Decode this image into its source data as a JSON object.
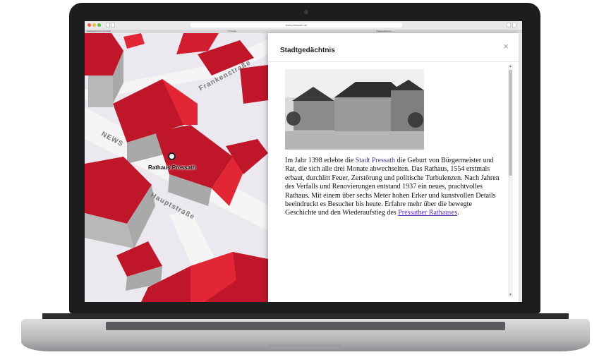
{
  "browser": {
    "url": "www.pressath.de",
    "tabs": [
      "Stadtgedächtnis Pressath",
      "Pressath",
      "Stadtgedächtnis"
    ]
  },
  "map": {
    "marker_label": "Rathaus Pressath",
    "streets": [
      "Frankenstraße",
      "NEWS",
      "Hauptstraße"
    ],
    "colors": {
      "roof": "#c0162a",
      "roof_light": "#e32636",
      "wall": "#a9a9a9",
      "ground": "#ece8f0",
      "road": "#f5f5f5"
    }
  },
  "panel": {
    "title": "Stadtgedächtnis",
    "close_icon": "close-icon",
    "body": {
      "part1": "Im Jahr 1398 erlebte die ",
      "link_city": "Stadt Pressath",
      "part2": " die Geburt von Bürgermeister und Rat, die sich alle drei Monate abwechselten. Das Rathaus, 1554 erstmals erbaut, durchlitt Feuer, Zerstörung und politische Turbulenzen. Nach Jahren des Verfalls und Renovierungen entstand 1937 ein neues, prachtvolles Rathaus. Mit einem über sechs Meter hohen Erker und kunstvollen Details beeindruckt es Besucher bis heute. Erfahre mehr über die bewegte Geschichte und den Wiederaufstieg des ",
      "link_rathaus": "Pressather Rathauses",
      "part3": "."
    }
  }
}
